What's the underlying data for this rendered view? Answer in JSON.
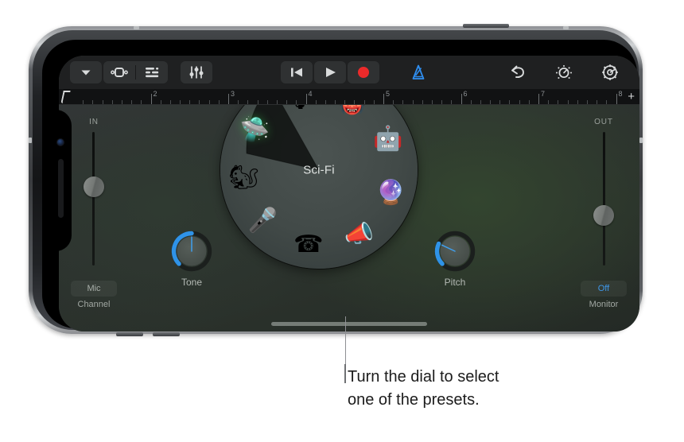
{
  "caption": {
    "line1": "Turn the dial to select",
    "line2": "one of the presets."
  },
  "toolbar": {
    "buttons": [
      {
        "name": "navigation-chevron",
        "icon": "chevron-down-icon",
        "label": "Navigation"
      },
      {
        "name": "loops-browser",
        "icon": "cycle-icon",
        "label": "Loop Browser"
      },
      {
        "name": "track-view",
        "icon": "track-list-icon",
        "label": "Tracks View"
      },
      {
        "name": "mixer",
        "icon": "faders-icon",
        "label": "Mixer"
      },
      {
        "name": "rewind",
        "icon": "rewind-icon",
        "label": "Go to Beginning"
      },
      {
        "name": "play",
        "icon": "play-icon",
        "label": "Play"
      },
      {
        "name": "record",
        "icon": "record-icon",
        "label": "Record"
      },
      {
        "name": "metronome",
        "icon": "metronome-icon",
        "label": "Metronome"
      },
      {
        "name": "undo",
        "icon": "undo-icon",
        "label": "Undo"
      },
      {
        "name": "fx",
        "icon": "fx-knob-icon",
        "label": "FX"
      },
      {
        "name": "settings",
        "icon": "gear-icon",
        "label": "Settings"
      }
    ],
    "record_color": "#eb2a2a",
    "metronome_color": "#2f8ef0"
  },
  "ruler": {
    "bars": [
      "2",
      "3",
      "4",
      "5",
      "6",
      "7",
      "8"
    ],
    "add_label": "+",
    "playhead_position": "1"
  },
  "left_strip": {
    "slider_label": "IN",
    "slider_value": 40,
    "button_label": "Mic",
    "caption": "Channel"
  },
  "right_strip": {
    "slider_label": "OUT",
    "slider_value": 62,
    "button_label": "Off",
    "button_color": "#3f97e8",
    "caption": "Monitor"
  },
  "knobs": [
    {
      "name": "tone-knob",
      "label": "Tone",
      "value": 50,
      "arc_color": "#2f93e8"
    },
    {
      "name": "pitch-knob",
      "label": "Pitch",
      "value": 26,
      "arc_color": "#2f93e8"
    }
  ],
  "dial": {
    "center_label": "Sci-Fi",
    "selected_index": 0,
    "presets": [
      {
        "name": "sci-fi",
        "label": "Sci-Fi",
        "glyph": "🛸",
        "angle": -58
      },
      {
        "name": "clean",
        "label": "Clean",
        "glyph": "🎙",
        "angle": -16
      },
      {
        "name": "monster",
        "label": "Monster",
        "glyph": "👹",
        "angle": 26
      },
      {
        "name": "robot",
        "label": "Robot",
        "glyph": "🤖",
        "angle": 66
      },
      {
        "name": "cosmic",
        "label": "Cosmic",
        "glyph": "🔮",
        "angle": 108
      },
      {
        "name": "megaphone",
        "label": "Megaphone",
        "glyph": "📣",
        "angle": 148
      },
      {
        "name": "telephone",
        "label": "Telephone",
        "glyph": "☎",
        "angle": 188
      },
      {
        "name": "vintage-mic",
        "label": "Vintage",
        "glyph": "🎤",
        "angle": 228
      },
      {
        "name": "chipmunk",
        "label": "Chipmunk",
        "glyph": "🐿",
        "angle": 264
      }
    ]
  },
  "colors": {
    "accent_blue": "#2f93e8",
    "record_red": "#eb2a2a",
    "app_bg": "#2e3331",
    "toolbar_bg": "#1f2021"
  }
}
